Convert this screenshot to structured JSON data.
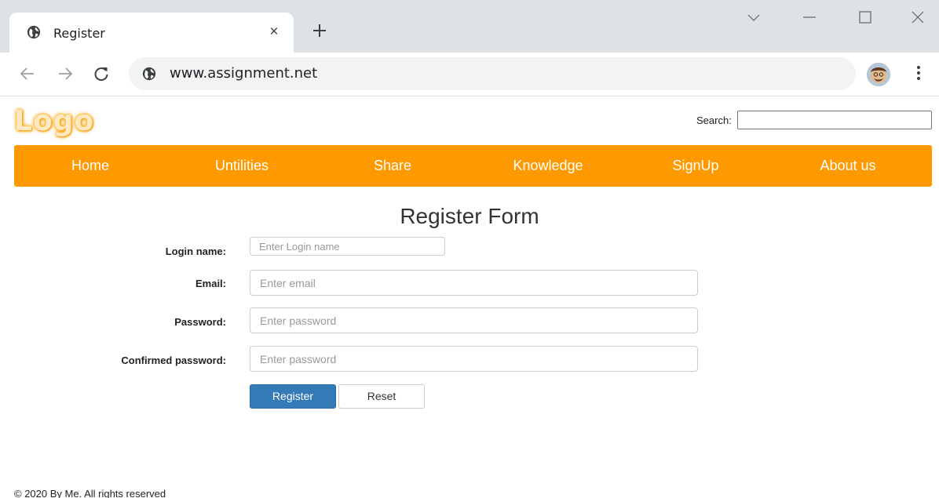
{
  "browser": {
    "tab_title": "Register",
    "tab_close": "×",
    "url": "www.assignment.net"
  },
  "header": {
    "logo_text": "Logo",
    "search_label": "Search:",
    "search_value": ""
  },
  "nav": {
    "items": [
      {
        "label": "Home"
      },
      {
        "label": "Untilities"
      },
      {
        "label": "Share"
      },
      {
        "label": "Knowledge"
      },
      {
        "label": "SignUp"
      },
      {
        "label": "About us"
      }
    ],
    "color": "#ff9900"
  },
  "form": {
    "title": "Register Form",
    "login_label": "Login name:",
    "login_placeholder": "Enter Login name",
    "email_label": "Email:",
    "email_placeholder": "Enter email",
    "password_label": "Password:",
    "password_placeholder": "Enter password",
    "confirm_label": "Confirmed password:",
    "confirm_placeholder": "Enter password",
    "register_label": "Register",
    "reset_label": "Reset",
    "register_color": "#337ab7"
  },
  "footer": {
    "text": "© 2020 By Me. All rights reserved"
  }
}
